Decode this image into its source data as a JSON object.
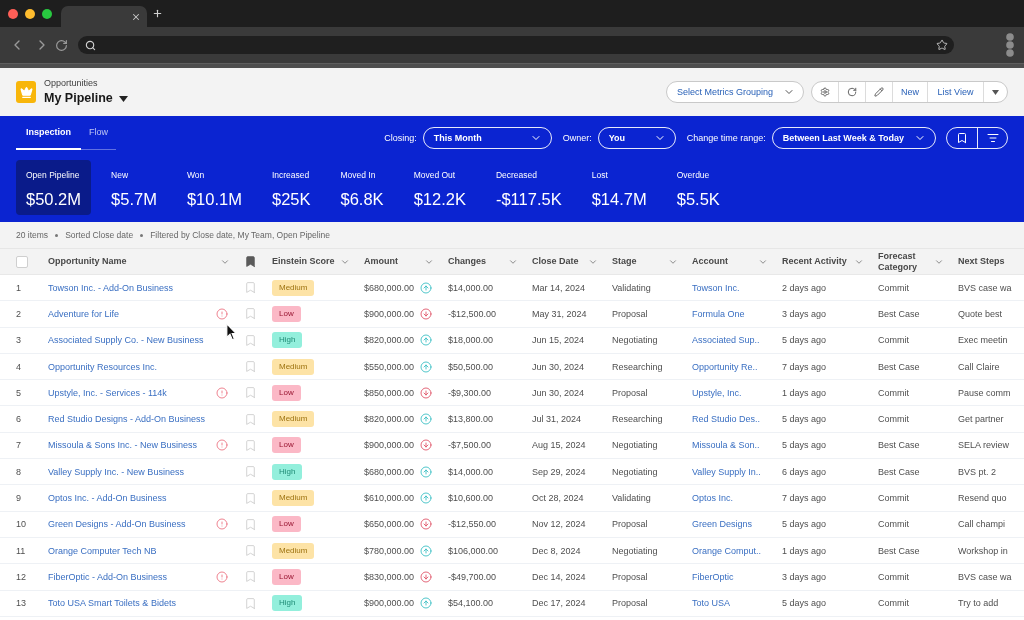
{
  "header": {
    "object_label": "Opportunities",
    "list_name": "My Pipeline",
    "metrics_grouping": "Select Metrics Grouping",
    "buttons": [
      "New",
      "List View"
    ]
  },
  "tabs": [
    {
      "label": "Inspection",
      "selected": true
    },
    {
      "label": "Flow",
      "selected": false
    }
  ],
  "filters": [
    {
      "label": "Closing:",
      "value": "This Month"
    },
    {
      "label": "Owner:",
      "value": "You"
    },
    {
      "label": "Change time range:",
      "value": "Between Last Week & Today"
    }
  ],
  "metrics": [
    {
      "label": "Open Pipeline",
      "value": "$50.2M",
      "selected": true
    },
    {
      "label": "New",
      "value": "$5.7M",
      "selected": false
    },
    {
      "label": "Won",
      "value": "$10.1M",
      "selected": false
    },
    {
      "label": "Increased",
      "value": "$25K",
      "selected": false
    },
    {
      "label": "Moved In",
      "value": "$6.8K",
      "selected": false
    },
    {
      "label": "Moved Out",
      "value": "$12.2K",
      "selected": false
    },
    {
      "label": "Decreased",
      "value": "-$117.5K",
      "selected": false
    },
    {
      "label": "Lost",
      "value": "$14.7M",
      "selected": false
    },
    {
      "label": "Overdue",
      "value": "$5.5K",
      "selected": false
    }
  ],
  "summary": [
    "20 items",
    "Sorted Close date",
    "Filtered by Close date, My Team, Open Pipeline"
  ],
  "table": {
    "select_all": {
      "checked": false
    },
    "columns": [
      {
        "kind": "text",
        "label": "Opportunity Name",
        "menu": true
      },
      {
        "kind": "bookmark"
      },
      {
        "kind": "text",
        "label": "Einstein Score",
        "menu": true
      },
      {
        "kind": "text",
        "label": "Amount",
        "menu": true
      },
      {
        "kind": "text",
        "label": "Changes",
        "menu": true
      },
      {
        "kind": "text",
        "label": "Close Date",
        "menu": true
      },
      {
        "kind": "text",
        "label": "Stage",
        "menu": true
      },
      {
        "kind": "text",
        "label": "Account",
        "menu": true
      },
      {
        "kind": "text",
        "label": "Recent Activity",
        "menu": true
      },
      {
        "kind": "text",
        "label": "Forecast Category",
        "menu": true
      },
      {
        "kind": "text",
        "label": "Next Steps",
        "menu": false
      }
    ],
    "rows": [
      {
        "number": "1",
        "name": "Towson Inc. - Add-On Business",
        "warning": false,
        "bookmarked": false,
        "score": {
          "label": "Medium",
          "color": "#fde3a6"
        },
        "amount": "$680,000.00",
        "increased": true,
        "change": "$14,000.00",
        "close_date": "Mar 14, 2024",
        "stage": "Validating",
        "account": "Towson Inc.",
        "recent_activity": "2 days ago",
        "forecast_category": "Commit",
        "next_steps": "BVS case wa"
      },
      {
        "number": "2",
        "name": "Adventure for Life",
        "warning": true,
        "bookmarked": false,
        "score": {
          "label": "Low",
          "color": "#fbb8c6"
        },
        "amount": "$900,000.00",
        "increased": false,
        "change": "-$12,500.00",
        "close_date": "May 31, 2024",
        "stage": "Proposal",
        "account": "Formula One",
        "recent_activity": "3 days ago",
        "forecast_category": "Best Case",
        "next_steps": "Quote best"
      },
      {
        "number": "3",
        "name": "Associated Supply Co. - New Business",
        "warning": false,
        "bookmarked": false,
        "score": {
          "label": "High",
          "color": "#93efdc"
        },
        "amount": "$820,000.00",
        "increased": true,
        "change": "$18,000.00",
        "close_date": "Jun 15, 2024",
        "stage": "Negotiating",
        "account": "Associated Sup..",
        "recent_activity": "5 days ago",
        "forecast_category": "Commit",
        "next_steps": "Exec meetin"
      },
      {
        "number": "4",
        "name": "Opportunity Resources Inc.",
        "warning": false,
        "bookmarked": false,
        "score": {
          "label": "Medium",
          "color": "#fde3a6"
        },
        "amount": "$550,000.00",
        "increased": true,
        "change": "$50,500.00",
        "close_date": "Jun 30, 2024",
        "stage": "Researching",
        "account": "Opportunity Re..",
        "recent_activity": "7 days ago",
        "forecast_category": "Best Case",
        "next_steps": "Call Claire"
      },
      {
        "number": "5",
        "name": "Upstyle, Inc. - Services - 114k",
        "warning": true,
        "bookmarked": false,
        "score": {
          "label": "Low",
          "color": "#fbb8c6"
        },
        "amount": "$850,000.00",
        "increased": false,
        "change": "-$9,300.00",
        "close_date": "Jun 30, 2024",
        "stage": "Proposal",
        "account": "Upstyle, Inc.",
        "recent_activity": "1 days ago",
        "forecast_category": "Commit",
        "next_steps": "Pause comm"
      },
      {
        "number": "6",
        "name": "Red Studio Designs - Add-On Business",
        "warning": false,
        "bookmarked": false,
        "score": {
          "label": "Medium",
          "color": "#fde3a6"
        },
        "amount": "$820,000.00",
        "increased": true,
        "change": "$13,800.00",
        "close_date": "Jul 31, 2024",
        "stage": "Researching",
        "account": "Red Studio Des..",
        "recent_activity": "5 days ago",
        "forecast_category": "Commit",
        "next_steps": "Get partner"
      },
      {
        "number": "7",
        "name": "Missoula & Sons Inc. - New Business",
        "warning": true,
        "bookmarked": false,
        "score": {
          "label": "Low",
          "color": "#fbb8c6"
        },
        "amount": "$900,000.00",
        "increased": false,
        "change": "-$7,500.00",
        "close_date": "Aug 15, 2024",
        "stage": "Negotiating",
        "account": "Missoula & Son..",
        "recent_activity": "5 days ago",
        "forecast_category": "Best Case",
        "next_steps": "SELA review"
      },
      {
        "number": "8",
        "name": "Valley Supply Inc. - New Business",
        "warning": false,
        "bookmarked": false,
        "score": {
          "label": "High",
          "color": "#93efdc"
        },
        "amount": "$680,000.00",
        "increased": true,
        "change": "$14,000.00",
        "close_date": "Sep 29, 2024",
        "stage": "Negotiating",
        "account": "Valley Supply In..",
        "recent_activity": "6 days ago",
        "forecast_category": "Best Case",
        "next_steps": "BVS pt. 2"
      },
      {
        "number": "9",
        "name": "Optos Inc. - Add-On Business",
        "warning": false,
        "bookmarked": false,
        "score": {
          "label": "Medium",
          "color": "#fde3a6"
        },
        "amount": "$610,000.00",
        "increased": true,
        "change": "$10,600.00",
        "close_date": "Oct 28, 2024",
        "stage": "Validating",
        "account": "Optos Inc.",
        "recent_activity": "7 days ago",
        "forecast_category": "Commit",
        "next_steps": "Resend quo"
      },
      {
        "number": "10",
        "name": "Green Designs - Add-On Business",
        "warning": true,
        "bookmarked": false,
        "score": {
          "label": "Low",
          "color": "#fbb8c6"
        },
        "amount": "$650,000.00",
        "increased": false,
        "change": "-$12,550.00",
        "close_date": "Nov 12, 2024",
        "stage": "Proposal",
        "account": "Green Designs",
        "recent_activity": "5 days ago",
        "forecast_category": "Commit",
        "next_steps": "Call champi"
      },
      {
        "number": "11",
        "name": "Orange Computer Tech NB",
        "warning": false,
        "bookmarked": false,
        "score": {
          "label": "Medium",
          "color": "#fde3a6"
        },
        "amount": "$780,000.00",
        "increased": true,
        "change": "$106,000.00",
        "close_date": "Dec 8, 2024",
        "stage": "Negotiating",
        "account": "Orange Comput..",
        "recent_activity": "1 days ago",
        "forecast_category": "Best Case",
        "next_steps": "Workshop in"
      },
      {
        "number": "12",
        "name": "FiberOptic - Add-On Business",
        "warning": true,
        "bookmarked": false,
        "score": {
          "label": "Low",
          "color": "#fbb8c6"
        },
        "amount": "$830,000.00",
        "increased": false,
        "change": "-$49,700.00",
        "close_date": "Dec 14, 2024",
        "stage": "Proposal",
        "account": "FiberOptic",
        "recent_activity": "3 days ago",
        "forecast_category": "Commit",
        "next_steps": "BVS case wa"
      },
      {
        "number": "13",
        "name": "Toto USA Smart Toilets & Bidets",
        "warning": false,
        "bookmarked": false,
        "score": {
          "label": "High",
          "color": "#93efdc"
        },
        "amount": "$900,000.00",
        "increased": true,
        "change": "$54,100.00",
        "close_date": "Dec 17, 2024",
        "stage": "Proposal",
        "account": "Toto USA",
        "recent_activity": "5 days ago",
        "forecast_category": "Commit",
        "next_steps": "Try to add"
      }
    ]
  }
}
